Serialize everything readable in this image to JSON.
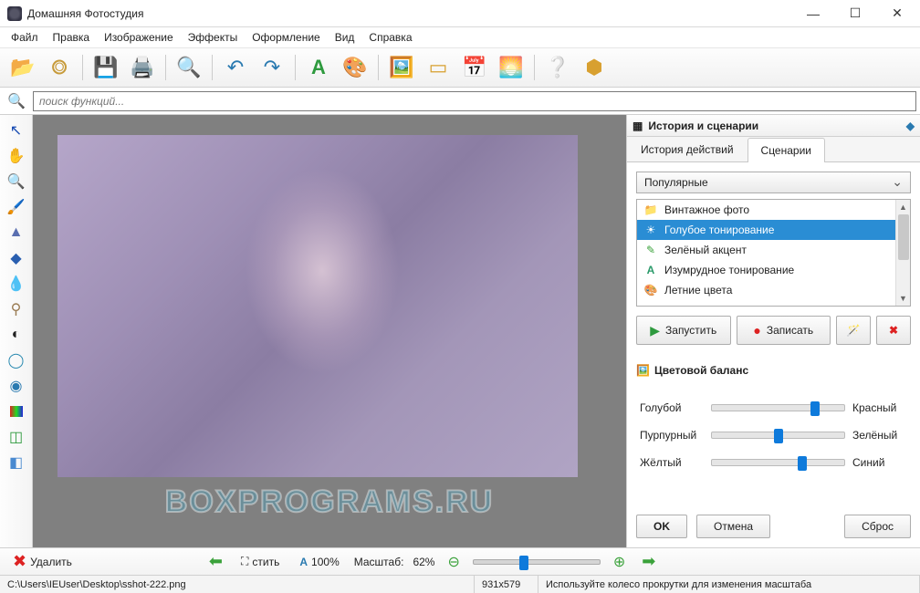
{
  "window": {
    "title": "Домашняя Фотостудия"
  },
  "menu": {
    "items": [
      "Файл",
      "Правка",
      "Изображение",
      "Эффекты",
      "Оформление",
      "Вид",
      "Справка"
    ]
  },
  "toolbar": {
    "icons": [
      "open-folder",
      "film-reel",
      "save-disk",
      "print",
      "page-preview",
      "undo",
      "redo",
      "text-a",
      "palette",
      "image-thumb",
      "image-frame",
      "calendar",
      "image-sun",
      "help",
      "home"
    ]
  },
  "search": {
    "placeholder": "поиск функций..."
  },
  "left_tools": [
    "pointer",
    "hand",
    "zoom",
    "brush",
    "drop-dark",
    "drop-light",
    "blur",
    "stamp",
    "bw-circle",
    "swirl",
    "eye",
    "color-bars",
    "crop",
    "eraser"
  ],
  "right_panel": {
    "title": "История и сценарии",
    "tabs": [
      "История действий",
      "Сценарии"
    ],
    "active_tab": 1,
    "dropdown": "Популярные",
    "presets": [
      {
        "label": "Винтажное фото",
        "icon": "folder",
        "color": "#e8a33d"
      },
      {
        "label": "Голубое тонирование",
        "icon": "sun",
        "color": "#ffffff"
      },
      {
        "label": "Зелёный акцент",
        "icon": "pencil",
        "color": "#3ba23b"
      },
      {
        "label": "Изумрудное тонирование",
        "icon": "letter-a",
        "color": "#2a9a6a"
      },
      {
        "label": "Летние цвета",
        "icon": "palette",
        "color": "#d98c2e"
      }
    ],
    "selected_preset": 1,
    "actions": {
      "run": "Запустить",
      "record": "Записать"
    },
    "section": "Цветовой баланс",
    "balance": [
      {
        "left": "Голубой",
        "right": "Красный",
        "value": 78
      },
      {
        "left": "Пурпурный",
        "right": "Зелёный",
        "value": 50
      },
      {
        "left": "Жёлтый",
        "right": "Синий",
        "value": 68
      }
    ],
    "buttons": {
      "ok": "OK",
      "cancel": "Отмена",
      "reset": "Сброс"
    }
  },
  "bottom": {
    "delete": "Удалить",
    "fit": "стить",
    "zoom_a": "100%",
    "zoom_label": "Масштаб:",
    "zoom_value": "62%"
  },
  "status": {
    "path": "C:\\Users\\IEUser\\Desktop\\sshot-222.png",
    "dimensions": "931x579",
    "hint": "Используйте колесо прокрутки для изменения масштаба"
  },
  "watermark": "BOXPROGRAMS.RU"
}
